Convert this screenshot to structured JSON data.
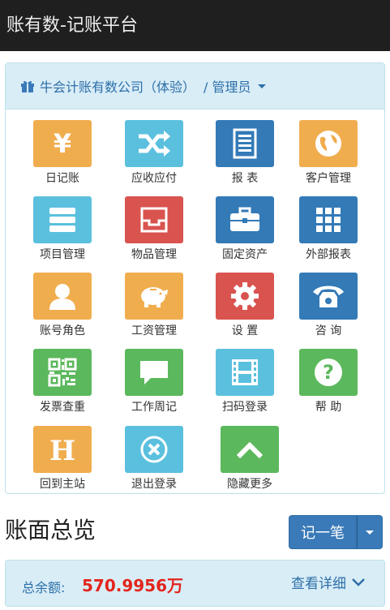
{
  "header": {
    "title": "账有数-记账平台"
  },
  "panel": {
    "company": "牛会计账有数公司（体验）",
    "role": "/ 管理员"
  },
  "tiles": [
    {
      "label": "日记账",
      "icon": "yen-icon",
      "color": "#f0ad4e"
    },
    {
      "label": "应收应付",
      "icon": "shuffle-icon",
      "color": "#5bc0de"
    },
    {
      "label": "报 表",
      "icon": "report-icon",
      "color": "#337ab7"
    },
    {
      "label": "客户管理",
      "icon": "globe-icon",
      "color": "#f0ad4e"
    },
    {
      "label": "项目管理",
      "icon": "server-icon",
      "color": "#5bc0de"
    },
    {
      "label": "物品管理",
      "icon": "inbox-icon",
      "color": "#d9534f"
    },
    {
      "label": "固定资产",
      "icon": "briefcase-icon",
      "color": "#337ab7"
    },
    {
      "label": "外部报表",
      "icon": "grid-icon",
      "color": "#337ab7"
    },
    {
      "label": "账号角色",
      "icon": "user-icon",
      "color": "#f0ad4e"
    },
    {
      "label": "工资管理",
      "icon": "piggy-bank-icon",
      "color": "#f0ad4e"
    },
    {
      "label": "设 置",
      "icon": "gear-icon",
      "color": "#d9534f"
    },
    {
      "label": "咨 询",
      "icon": "phone-icon",
      "color": "#337ab7"
    },
    {
      "label": "发票查重",
      "icon": "qrcode-icon",
      "color": "#5cb85c"
    },
    {
      "label": "工作周记",
      "icon": "comment-icon",
      "color": "#5cb85c"
    },
    {
      "label": "扫码登录",
      "icon": "film-icon",
      "color": "#5bc0de"
    },
    {
      "label": "帮 助",
      "icon": "question-icon",
      "color": "#5cb85c"
    },
    {
      "label": "回到主站",
      "icon": "h-letter-icon",
      "color": "#f0ad4e"
    },
    {
      "label": "退出登录",
      "icon": "close-circle-icon",
      "color": "#5bc0de"
    },
    {
      "label": "隐藏更多",
      "icon": "chevron-up-icon",
      "color": "#5cb85c"
    }
  ],
  "overview": {
    "title": "账面总览",
    "record_button": "记一笔"
  },
  "summary": {
    "label": "总余额:",
    "amount": "570.9956万",
    "detail_link": "查看详细"
  }
}
